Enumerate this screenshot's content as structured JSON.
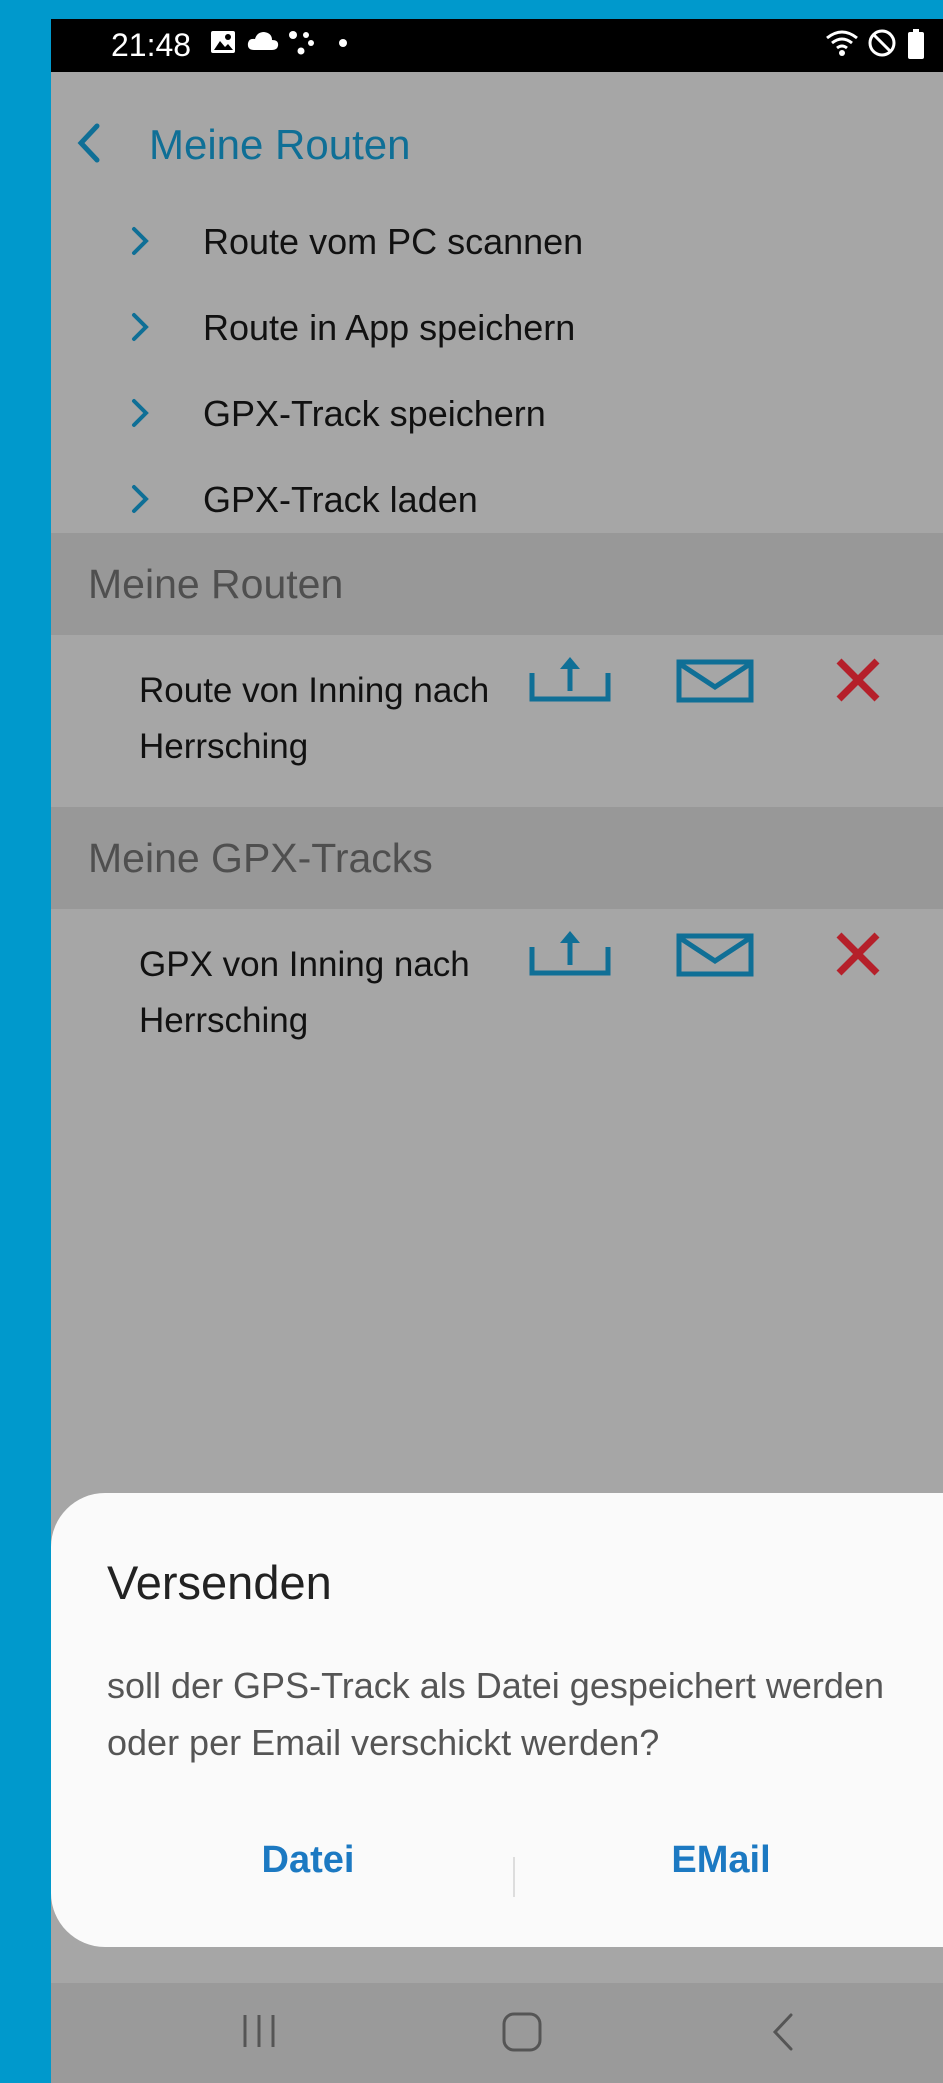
{
  "status_bar": {
    "time": "21:48",
    "left_icons": [
      "image-icon",
      "cloud-icon",
      "assistant-dots-icon",
      "dot-icon"
    ],
    "right_icons": [
      "wifi-icon",
      "do-not-disturb-icon",
      "battery-icon"
    ]
  },
  "header": {
    "title": "Meine Routen",
    "back_icon": "chevron-left-icon"
  },
  "menu": {
    "items": [
      {
        "label": "Route vom PC scannen"
      },
      {
        "label": "Route in App speichern"
      },
      {
        "label": "GPX-Track speichern"
      },
      {
        "label": "GPX-Track laden"
      }
    ]
  },
  "sections": [
    {
      "title": "Meine Routen",
      "entries": [
        {
          "name": "Route von Inning nach Herrsching"
        }
      ]
    },
    {
      "title": "Meine GPX-Tracks",
      "entries": [
        {
          "name": "GPX von Inning nach Herrsching"
        }
      ]
    }
  ],
  "dialog": {
    "title": "Versenden",
    "message": "soll der GPS-Track als Datei gespeichert werden oder per Email verschickt werden?",
    "buttons": {
      "file": "Datei",
      "email": "EMail"
    }
  },
  "navbar": {
    "icons": [
      "recent-apps-icon",
      "home-icon",
      "back-icon"
    ]
  },
  "colors": {
    "accent_blue": "#0f6f96",
    "delete_red": "#b5202a",
    "dialog_button_blue": "#1c79c2",
    "frame_blue": "#0099cc"
  }
}
